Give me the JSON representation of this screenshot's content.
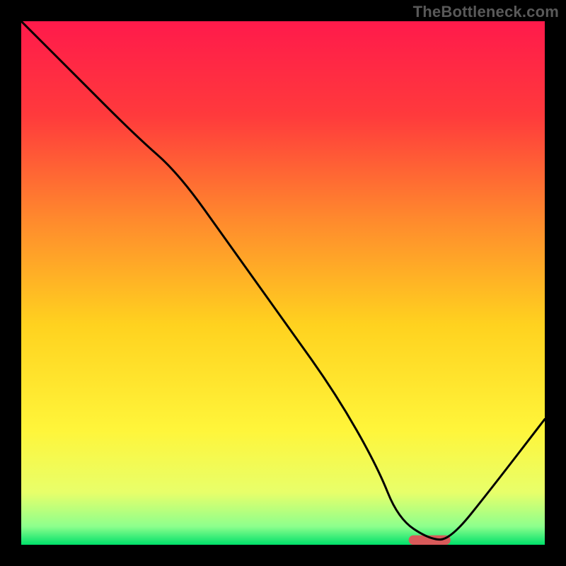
{
  "watermark": "TheBottleneck.com",
  "chart_data": {
    "type": "line",
    "title": "",
    "xlabel": "",
    "ylabel": "",
    "xlim": [
      0,
      100
    ],
    "ylim": [
      0,
      100
    ],
    "grid": false,
    "legend": false,
    "gradient_stops": [
      {
        "offset": 0.0,
        "color": "#ff1a4b"
      },
      {
        "offset": 0.18,
        "color": "#ff3a3c"
      },
      {
        "offset": 0.38,
        "color": "#ff8a2d"
      },
      {
        "offset": 0.58,
        "color": "#ffd21f"
      },
      {
        "offset": 0.78,
        "color": "#fff53a"
      },
      {
        "offset": 0.9,
        "color": "#e8ff6a"
      },
      {
        "offset": 0.965,
        "color": "#8dff8d"
      },
      {
        "offset": 1.0,
        "color": "#00e06a"
      }
    ],
    "series": [
      {
        "name": "curve",
        "color": "#000000",
        "x": [
          0,
          10,
          22,
          30,
          40,
          50,
          60,
          68,
          72,
          78,
          82,
          90,
          100
        ],
        "y": [
          100,
          90,
          78,
          71,
          57,
          43,
          29,
          15,
          5,
          1,
          1,
          11,
          24
        ]
      }
    ],
    "marker": {
      "name": "optimal-range",
      "color": "#d85a5a",
      "x_start": 74,
      "x_end": 82,
      "y": 0.9,
      "height": 1.8
    }
  }
}
